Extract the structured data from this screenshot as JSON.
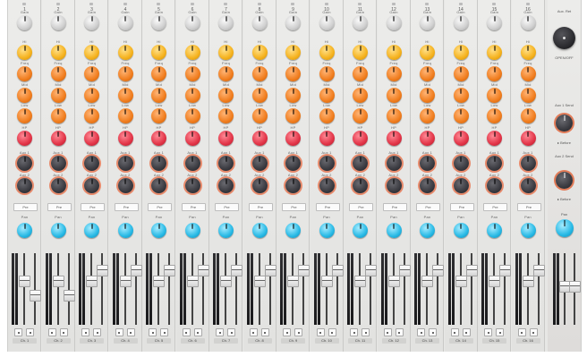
{
  "mixer": {
    "channels": [
      {
        "number": "1",
        "name": "Ch. 1",
        "fader_left": 0.62,
        "fader_right": 0.42
      },
      {
        "number": "2",
        "name": "Ch. 2",
        "fader_left": 0.62,
        "fader_right": 0.42
      },
      {
        "number": "3",
        "name": "Ch. 3",
        "fader_left": 0.62,
        "fader_right": 0.78
      },
      {
        "number": "4",
        "name": "Ch. 4",
        "fader_left": 0.62,
        "fader_right": 0.78
      },
      {
        "number": "5",
        "name": "Ch. 5",
        "fader_left": 0.62,
        "fader_right": 0.78
      },
      {
        "number": "6",
        "name": "Ch. 6",
        "fader_left": 0.62,
        "fader_right": 0.78
      },
      {
        "number": "7",
        "name": "Ch. 7",
        "fader_left": 0.62,
        "fader_right": 0.78
      },
      {
        "number": "8",
        "name": "Ch. 8",
        "fader_left": 0.62,
        "fader_right": 0.78
      },
      {
        "number": "9",
        "name": "Ch. 9",
        "fader_left": 0.62,
        "fader_right": 0.78
      },
      {
        "number": "10",
        "name": "Ch. 10",
        "fader_left": 0.62,
        "fader_right": 0.78
      },
      {
        "number": "11",
        "name": "Ch. 11",
        "fader_left": 0.62,
        "fader_right": 0.78
      },
      {
        "number": "12",
        "name": "Ch. 12",
        "fader_left": 0.62,
        "fader_right": 0.78
      },
      {
        "number": "13",
        "name": "Ch. 13",
        "fader_left": 0.62,
        "fader_right": 0.78
      },
      {
        "number": "14",
        "name": "Ch. 14",
        "fader_left": 0.62,
        "fader_right": 0.78
      },
      {
        "number": "15",
        "name": "Ch. 15",
        "fader_left": 0.62,
        "fader_right": 0.78
      },
      {
        "number": "16",
        "name": "Ch. 16",
        "fader_left": 0.62,
        "fader_right": 0.78
      }
    ],
    "labels": {
      "gain": "Gain",
      "hi": "Hi",
      "freq": "Freq",
      "mid": "Mid",
      "low": "Low",
      "hp": "HP",
      "aux1": "Aux 1",
      "aux2": "Aux 2",
      "pre": "Pre",
      "pan": "Pan"
    },
    "master": {
      "title": "Aux. Ret",
      "open_label": "OPEN/OFF",
      "aux1_send": "Aux 1 Send",
      "aux2_send": "Aux 2 Send",
      "before_label": "▸ Before",
      "pan": "Pan",
      "fader_left": 0.55,
      "fader_right": 0.55
    },
    "colors": {
      "gain": "#cfcfcf",
      "hi": "#f5b21e",
      "freq": "#f07d1e",
      "hp": "#e23447",
      "aux": "#3a3a40",
      "pan": "#27b9e5"
    }
  }
}
